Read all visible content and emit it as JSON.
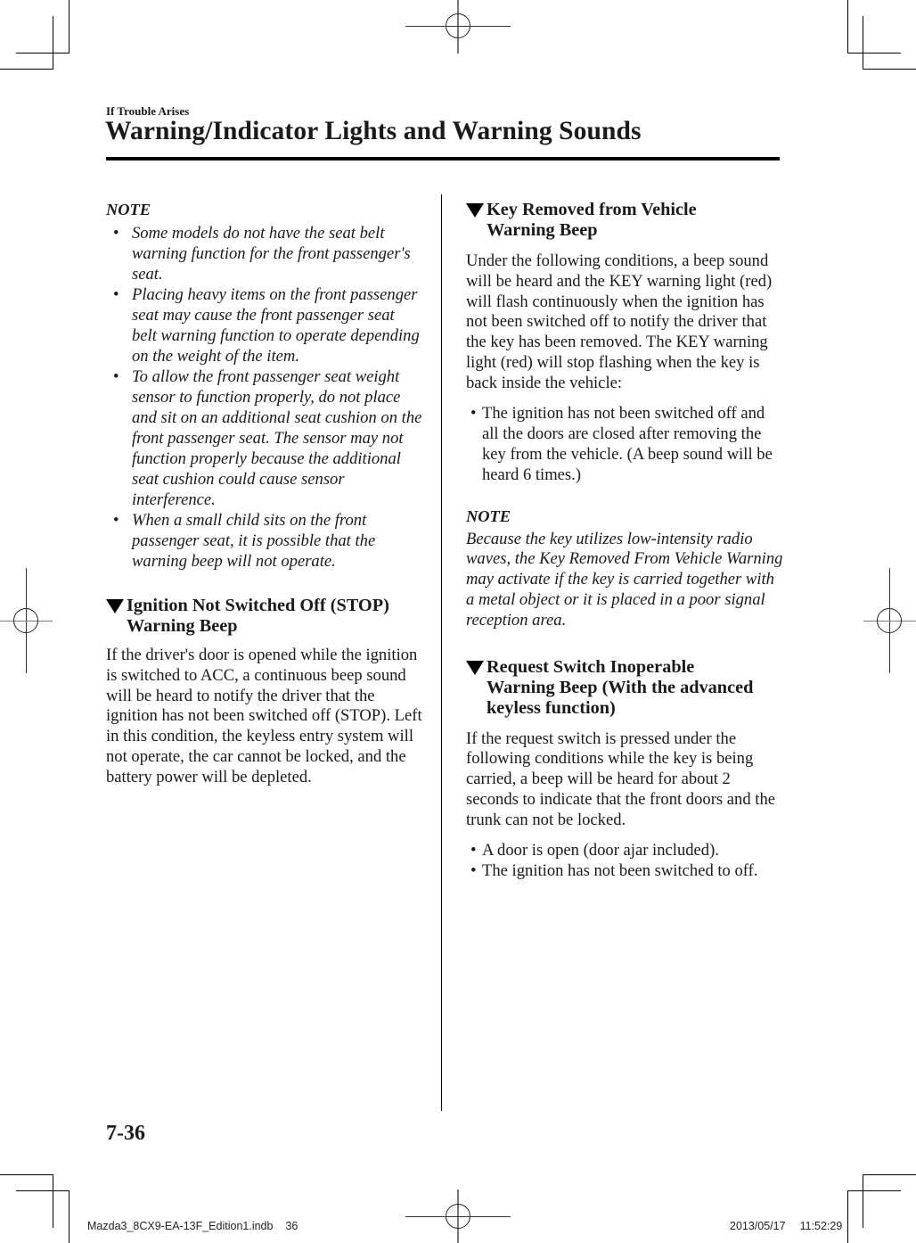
{
  "header": {
    "running_head": "If Trouble Arises",
    "title": "Warning/Indicator Lights and Warning Sounds"
  },
  "left_column": {
    "note": {
      "label": "NOTE",
      "items": [
        "Some models do not have the seat belt warning function for the front passenger's seat.",
        "Placing heavy items on the front passenger seat may cause the front passenger seat belt warning function to operate depending on the weight of the item.",
        "To allow the front passenger seat weight sensor to function properly, do not place and sit on an additional seat cushion on the front passenger seat. The sensor may not function properly because the additional seat cushion could cause sensor interference.",
        "When a small child sits on the front passenger seat, it is possible that the warning beep will not operate."
      ]
    },
    "section": {
      "heading_line1": "Ignition Not Switched Off (STOP)",
      "heading_line2": "Warning Beep",
      "body": "If the driver's door is opened while the ignition is switched to ACC, a continuous beep sound will be heard to notify the driver that the ignition has not been switched off (STOP). Left in this condition, the keyless entry system will not operate, the car cannot be locked, and the battery power will be depleted."
    }
  },
  "right_column": {
    "section1": {
      "heading_line1": "Key Removed from Vehicle",
      "heading_line2": "Warning Beep",
      "body": "Under the following conditions, a beep sound will be heard and the KEY warning light (red) will flash continuously when the ignition has not been switched off to notify the driver that the key has been removed. The KEY warning light (red) will stop flashing when the key is back inside the vehicle:",
      "bullets": [
        "The ignition has not been switched off and all the doors are closed after removing the key from the vehicle. (A beep sound will be heard 6 times.)"
      ],
      "note_label": "NOTE",
      "note_text": "Because the key utilizes low-intensity radio waves, the Key Removed From Vehicle Warning may activate if the key is carried together with a metal object or it is placed in a poor signal reception area."
    },
    "section2": {
      "heading_line1": "Request Switch Inoperable",
      "heading_line2": "Warning Beep (With the advanced",
      "heading_line3": "keyless function)",
      "body": "If the request switch is pressed under the following conditions while the key is being carried, a beep will be heard for about 2 seconds to indicate that the front doors and the trunk can not be locked.",
      "bullets": [
        "A door is open (door ajar included).",
        "The ignition has not been switched to off."
      ]
    }
  },
  "footer": {
    "page_number": "7-36",
    "slug_file": "Mazda3_8CX9-EA-13F_Edition1.indb",
    "slug_page": "36",
    "slug_date": "2013/05/17",
    "slug_time": "11:52:29"
  },
  "icons": {
    "section_marker": "down-triangle",
    "bullet": "•"
  }
}
